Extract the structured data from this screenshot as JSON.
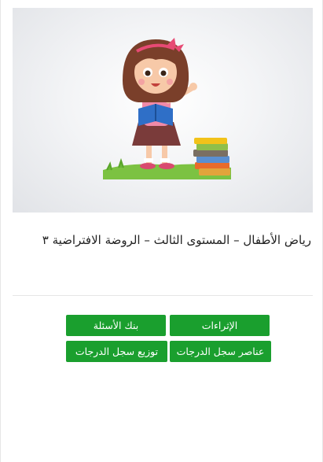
{
  "course": {
    "title": "رياض الأطفال – المستوى الثالث – الروضة الافتراضية ٣",
    "image_alt": "girl-reading-illustration"
  },
  "actions": {
    "enrichments": "الإثراءات",
    "question_bank": "بنك الأسئلة",
    "grade_book_items": "عناصر سجل الدرجات",
    "grade_book_distribution": "توزيع سجل الدرجات"
  },
  "colors": {
    "button_bg": "#1a9f2e",
    "button_text": "#ffffff",
    "title_text": "#222222"
  }
}
